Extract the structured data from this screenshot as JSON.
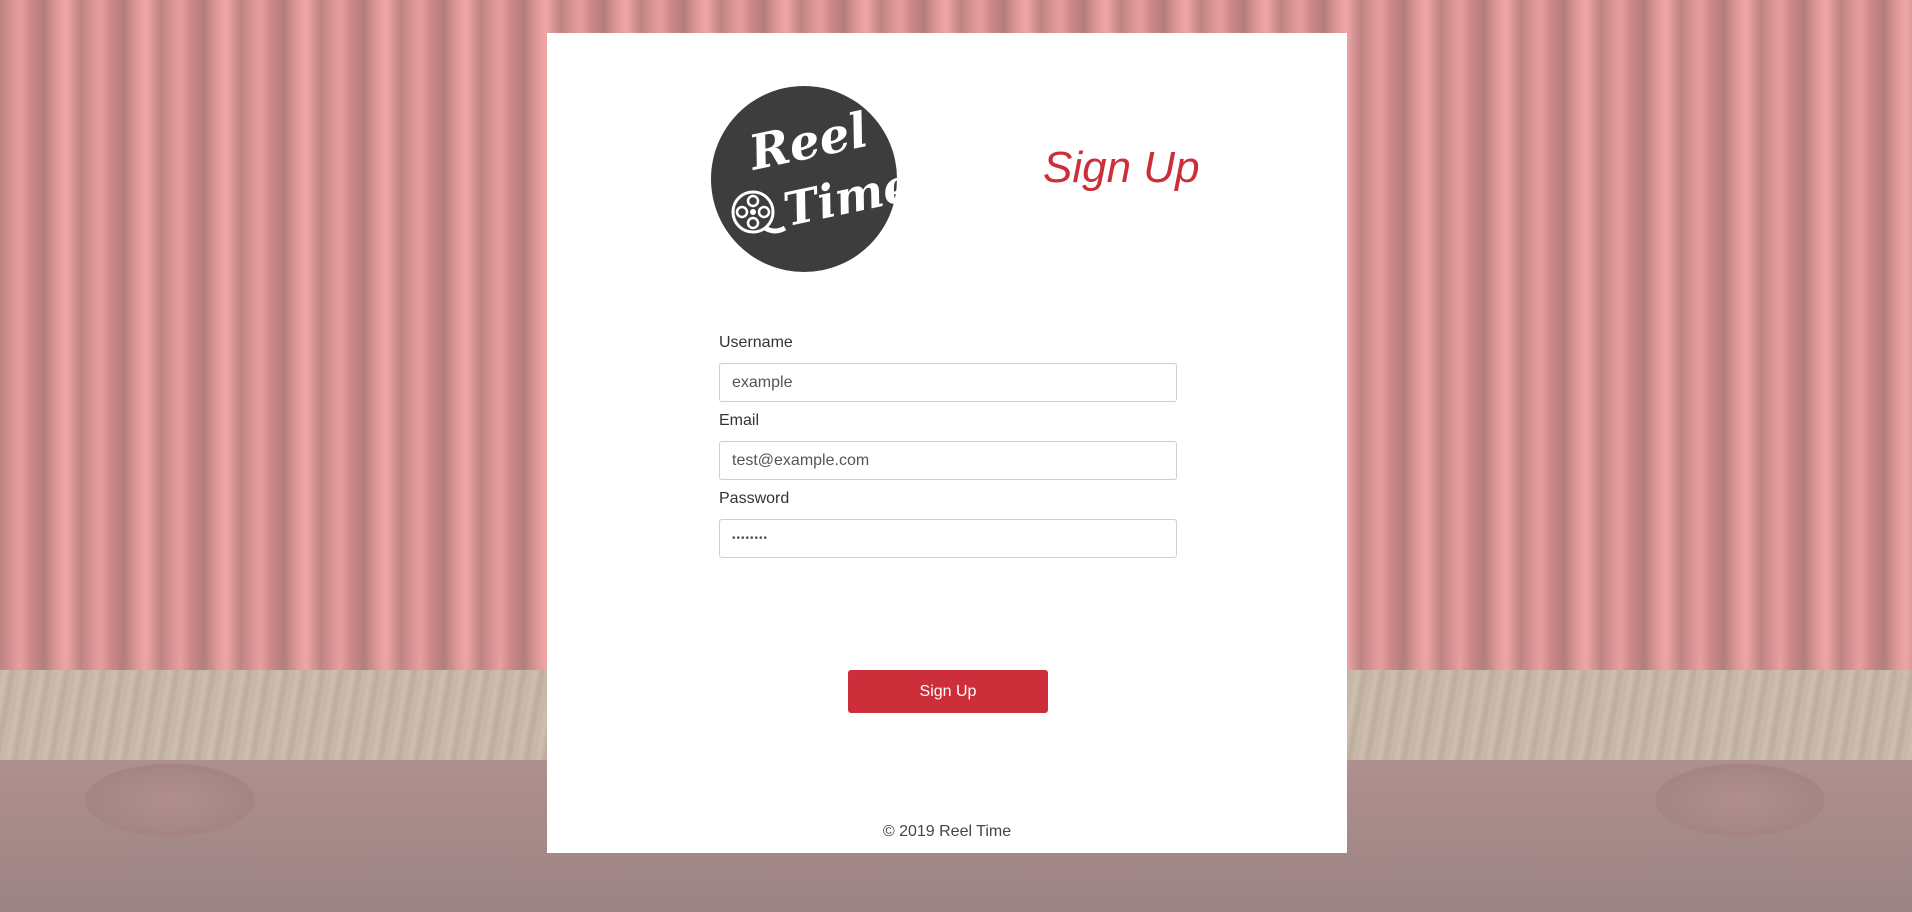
{
  "brand": {
    "logo_text_line1": "Reel",
    "logo_text_line2": "Time",
    "logo_icon": "film-reel-icon",
    "accent_color": "#cc2f3a",
    "logo_bg_color": "#3d3d3d"
  },
  "page": {
    "title": "Sign Up"
  },
  "form": {
    "username": {
      "label": "Username",
      "value": "example"
    },
    "email": {
      "label": "Email",
      "value": "test@example.com"
    },
    "password": {
      "label": "Password",
      "value": "••••••••"
    },
    "submit_label": "Sign Up"
  },
  "footer": {
    "text": "© 2019 Reel Time"
  }
}
